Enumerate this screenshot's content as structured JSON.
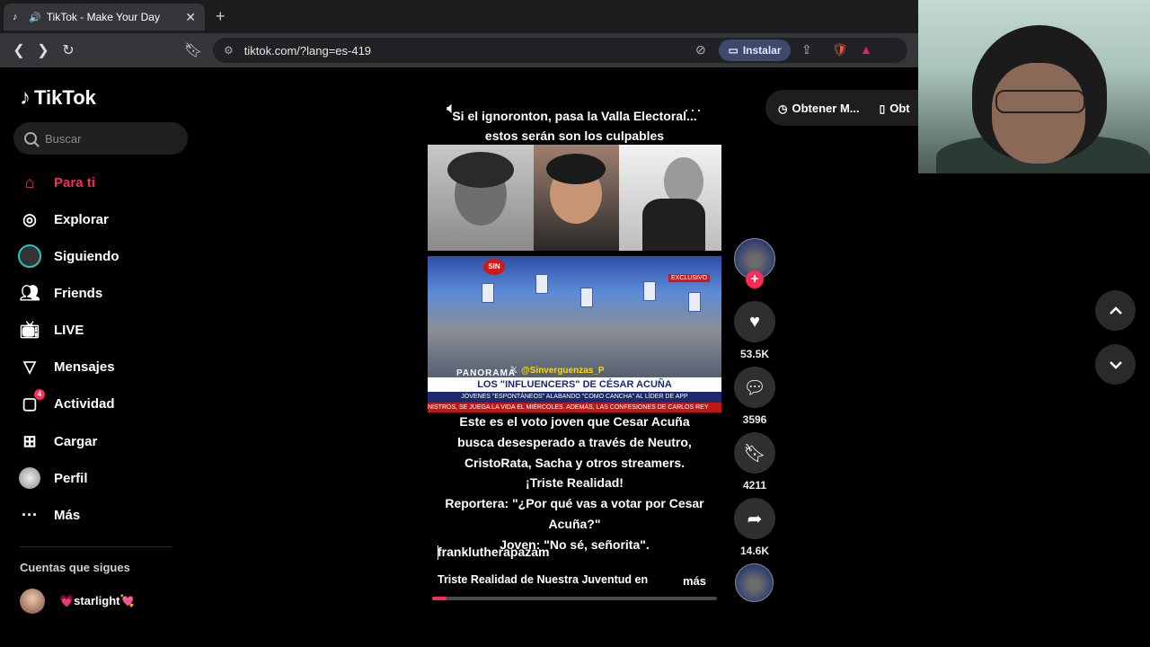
{
  "browser": {
    "tab_title": "TikTok - Make Your Day",
    "url": "tiktok.com/?lang=es-419",
    "install_label": "Instalar"
  },
  "sidebar": {
    "logo": "TikTok",
    "search_placeholder": "Buscar",
    "items": [
      {
        "label": "Para ti",
        "icon": "home-icon",
        "active": true
      },
      {
        "label": "Explorar",
        "icon": "compass-icon"
      },
      {
        "label": "Siguiendo",
        "icon": "following-icon"
      },
      {
        "label": "Friends",
        "icon": "friends-icon"
      },
      {
        "label": "LIVE",
        "icon": "live-icon"
      },
      {
        "label": "Mensajes",
        "icon": "messages-icon"
      },
      {
        "label": "Actividad",
        "icon": "activity-icon",
        "badge": "4"
      },
      {
        "label": "Cargar",
        "icon": "upload-icon"
      },
      {
        "label": "Perfil",
        "icon": "profile-icon"
      },
      {
        "label": "Más",
        "icon": "more-icon"
      }
    ],
    "following_title": "Cuentas que sigues",
    "following_accounts": [
      {
        "name": "💗starlight💘"
      }
    ]
  },
  "video": {
    "top_text_line1": "Si el ignoronton, pasa la Valla Electoral...",
    "top_text_line2": "estos serán son los culpables",
    "overlay_sin": "SIN",
    "overlay_exclusivo": "EXCLUSIVO",
    "overlay_handle": "@Sinverguenzas_P",
    "overlay_channel": "PANORAMA",
    "lower_third_title": "LOS \"INFLUENCERS\" DE CÉSAR ACUÑA",
    "lower_third_sub": "JÓVENES \"ESPONTÁNEOS\" ALABANDO \"COMO CANCHA\" AL LÍDER DE APP",
    "lower_third_ticker": "NISTROS, SE JUEGA LA VIDA EL MIÉRCOLES. ADEMÁS, LAS CONFESIONES DE CARLOS REY",
    "caption_lines": [
      "Este es el voto joven que Cesar Acuña",
      "busca desesperado a través de Neutro,",
      "CristoRata, Sacha y otros streamers.",
      "¡Triste Realidad!",
      "Reportera: \"¿Por qué vas a votar por Cesar",
      "Acuña?\"",
      "Joven: \"No sé, señorita\"."
    ],
    "author": "franklutherapazam",
    "description": "Triste Realidad de Nuestra Juventud en",
    "more_label": "más",
    "progress": 0.05
  },
  "actions": {
    "likes": "53.5K",
    "comments": "3596",
    "saves": "4211",
    "shares": "14.6K"
  },
  "top_right": {
    "get_app_label": "Obtener M...",
    "get_app2_label": "Obt"
  },
  "colors": {
    "accent": "#fe2c55",
    "background": "#000000"
  }
}
